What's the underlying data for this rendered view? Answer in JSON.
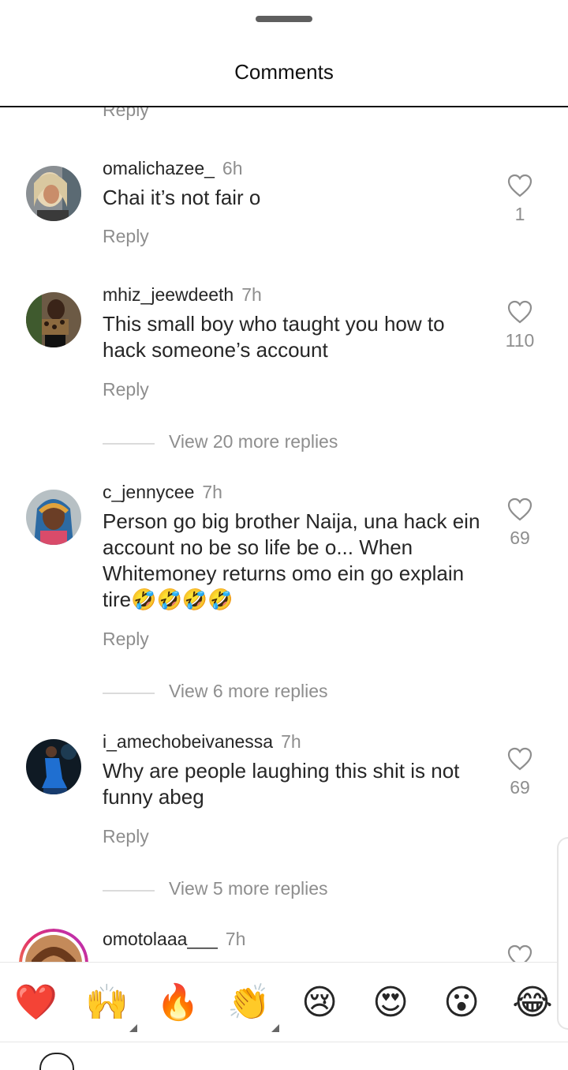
{
  "header": {
    "title": "Comments"
  },
  "partial_reply_label": "Reply",
  "comments": [
    {
      "username": "omalichazee_",
      "time": "6h",
      "text": "Chai it’s not fair o",
      "reply_label": "Reply",
      "likes": "1"
    },
    {
      "username": "mhiz_jeewdeeth",
      "time": "7h",
      "text": "This small boy who taught you how to hack someone’s account",
      "reply_label": "Reply",
      "likes": "110",
      "view_more": "View 20 more replies"
    },
    {
      "username": "c_jennycee",
      "time": "7h",
      "text": "Person go big brother Naija, una hack ein account  no be so life be o... When Whitemoney returns  omo ein go explain  tire🤣🤣🤣🤣",
      "reply_label": "Reply",
      "likes": "69",
      "view_more": "View 6 more replies"
    },
    {
      "username": "i_amechobeivanessa",
      "time": "7h",
      "text": "Why are people laughing this shit is not funny abeg",
      "reply_label": "Reply",
      "likes": "69",
      "view_more": "View 5 more replies"
    },
    {
      "username": "omotolaaa___",
      "time": "7h"
    }
  ],
  "emoji_bar": [
    {
      "emoji": "❤️",
      "name": "red-heart"
    },
    {
      "emoji": "🙌",
      "name": "raising-hands"
    },
    {
      "emoji": "🔥",
      "name": "fire"
    },
    {
      "emoji": "👏",
      "name": "clapping-hands"
    },
    {
      "emoji": "😢",
      "name": "crying-face"
    },
    {
      "emoji": "😍",
      "name": "heart-eyes"
    },
    {
      "emoji": "😮",
      "name": "surprised-face"
    },
    {
      "emoji": "😂",
      "name": "tears-of-joy"
    }
  ],
  "colors": {
    "text": "#262626",
    "secondary": "#8e8e8e",
    "divider": "#dbdbdb"
  }
}
